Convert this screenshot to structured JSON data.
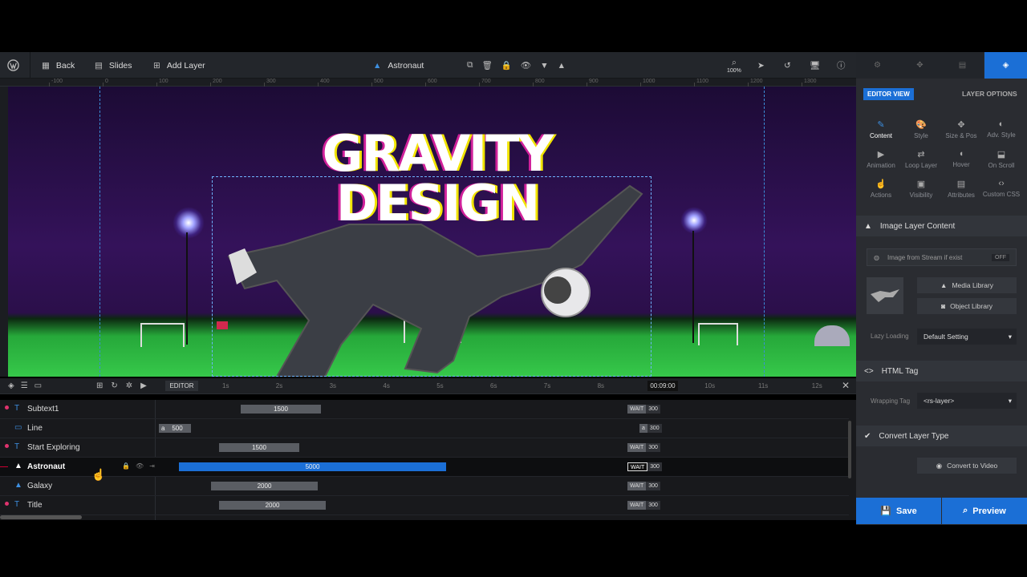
{
  "toolbar": {
    "back_label": "Back",
    "slides_label": "Slides",
    "add_layer_label": "Add Layer",
    "current_layer": "Astronaut",
    "zoom": "100%"
  },
  "ruler": {
    "top_marks": [
      "-100",
      "0",
      "100",
      "200",
      "300",
      "400",
      "500",
      "600",
      "700",
      "800",
      "900",
      "1000",
      "1100",
      "1200",
      "1300"
    ]
  },
  "canvas": {
    "title_line1": "GRAVITY",
    "title_line2": "DESIGN"
  },
  "timeline": {
    "editor_label": "EDITOR",
    "marks": [
      "1s",
      "2s",
      "3s",
      "4s",
      "5s",
      "6s",
      "7s",
      "8s",
      "9s",
      "10s",
      "11s",
      "12s"
    ],
    "end_time": "00:09:00"
  },
  "layers": [
    {
      "name": "Subtext1",
      "icon": "text-icon",
      "bar": "1500",
      "wait": "WAIT",
      "wait_value": "300"
    },
    {
      "name": "Line",
      "icon": "shape-icon",
      "bar": "500",
      "bar_prefix": "a",
      "wait": "a",
      "wait_value": "300"
    },
    {
      "name": "Start Exploring",
      "icon": "text-icon",
      "bar": "1500",
      "wait": "WAIT",
      "wait_value": "300"
    },
    {
      "name": "Astronaut",
      "icon": "image-icon",
      "bar": "5000",
      "wait": "WAIT",
      "wait_value": "300"
    },
    {
      "name": "Galaxy",
      "icon": "image-icon",
      "bar": "2000",
      "wait": "WAIT",
      "wait_value": "300"
    },
    {
      "name": "Title",
      "icon": "text-icon",
      "bar": "2000",
      "wait": "WAIT",
      "wait_value": "300"
    }
  ],
  "sidebar": {
    "editor_view": "EDITOR VIEW",
    "layer_options": "LAYER OPTIONS",
    "options": [
      {
        "label": "Content",
        "icon": "pencil-icon"
      },
      {
        "label": "Style",
        "icon": "palette-icon"
      },
      {
        "label": "Size & Pos",
        "icon": "move-icon"
      },
      {
        "label": "Adv. Style",
        "icon": "contrast-icon"
      },
      {
        "label": "Animation",
        "icon": "play-icon"
      },
      {
        "label": "Loop Layer",
        "icon": "loop-icon"
      },
      {
        "label": "Hover",
        "icon": "mouse-icon"
      },
      {
        "label": "On Scroll",
        "icon": "scroll-icon"
      },
      {
        "label": "Actions",
        "icon": "hand-icon"
      },
      {
        "label": "Visibility",
        "icon": "visibility-icon"
      },
      {
        "label": "Attributes",
        "icon": "file-icon"
      },
      {
        "label": "Custom CSS",
        "icon": "code-icon"
      }
    ],
    "image_layer_content": "Image Layer Content",
    "image_from_stream": "Image from Stream if exist",
    "toggle_off": "OFF",
    "media_library": "Media Library",
    "object_library": "Object Library",
    "lazy_loading_label": "Lazy Loading",
    "lazy_loading_value": "Default Setting",
    "html_tag": "HTML Tag",
    "wrapping_tag_label": "Wrapping Tag",
    "wrapping_tag_value": "<rs-layer>",
    "convert_layer_type": "Convert Layer Type",
    "convert_to_video": "Convert to Video",
    "save": "Save",
    "preview": "Preview"
  }
}
